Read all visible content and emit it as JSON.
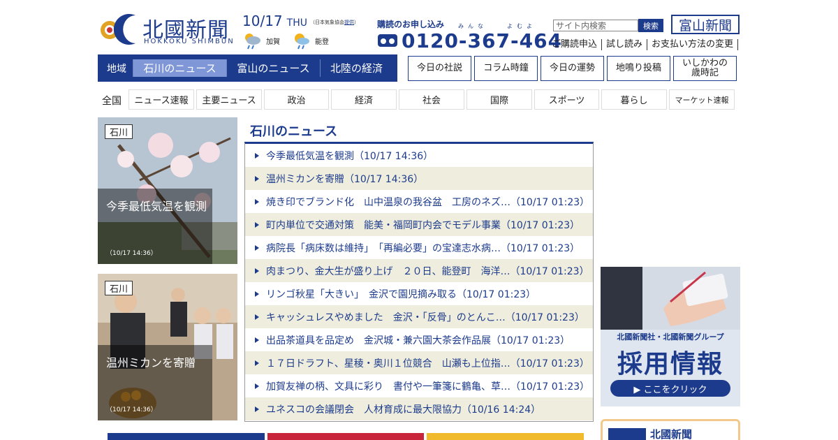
{
  "header": {
    "logo_name": "北國新聞",
    "logo_roman": "HOKKOKU SHIMBUN",
    "date": "10/17",
    "weekday": "THU",
    "weather_source_prefix": "（日本気象協会",
    "weather_source_link": "提供",
    "weather_source_suffix": "）",
    "weather": [
      {
        "label": "加賀",
        "icon": "cloud-sun-rain-icon"
      },
      {
        "label": "能登",
        "icon": "sun-rain-icon"
      }
    ],
    "subscribe_title": "購読のお申し込み",
    "phone_ruby": "みんな　　よむよ",
    "phone": "0120-367-464",
    "search_placeholder": "サイト内検索",
    "search_button": "検索",
    "toyama_link": "富山新聞",
    "links": [
      "ご購読申込",
      "試し読み",
      "お支払い方法の変更"
    ]
  },
  "region_nav": {
    "label": "地域",
    "tabs": [
      "石川のニュース",
      "富山のニュース",
      "北陸の経済"
    ],
    "active": 0
  },
  "box_links": [
    "今日の社説",
    "コラム時鐘",
    "今日の運勢",
    "地鳴り投稿",
    "いしかわの\n歳時記"
  ],
  "categories": {
    "label": "全国",
    "items": [
      "ニュース速報",
      "主要ニュース",
      "政治",
      "経済",
      "社会",
      "国際",
      "スポーツ",
      "暮らし",
      "マーケット速報"
    ]
  },
  "cards": [
    {
      "tag": "石川",
      "title": "今季最低気温を観測",
      "time": "（10/17 14:36）"
    },
    {
      "tag": "石川",
      "title": "温州ミカンを寄贈",
      "time": "（10/17 14:36）"
    }
  ],
  "news": {
    "title": "石川のニュース",
    "items": [
      "今季最低気温を観測（10/17 14:36）",
      "温州ミカンを寄贈（10/17 14:36）",
      "焼き印でブランド化　山中温泉の我谷盆　工房のネズ…（10/17 01:23）",
      "町内単位で交通対策　能美・福岡町内会でモデル事業（10/17 01:23）",
      "病院長「病床数は維持」　「再編必要」の宝達志水病…（10/17 01:23）",
      "肉まつり、金大生が盛り上げ　２０日、能登町　海洋…（10/17 01:23）",
      "リンゴ秋星「大きい」　金沢で園児摘み取る（10/17 01:23）",
      "キャッシュレスやめました　金沢・「反骨」のとんこ…（10/17 01:23）",
      "出品茶道具を品定め　金沢城・兼六園大茶会作品展（10/17 01:23）",
      "１７日ドラフト、星稜・奥川１位競合　山瀬も上位指…（10/17 01:23）",
      "加賀友禅の柄、文具に彩り　書付や一筆箋に鶴亀、草…（10/17 01:23）",
      "ユネスコの会議閉会　人材育成に最大限協力（10/16 14:24）"
    ]
  },
  "recruit": {
    "subtitle": "北國新聞社・北國新聞グループ",
    "title": "採用情報",
    "button": "▶ ここをクリック"
  },
  "bottom_box": {
    "title": "北國新聞"
  },
  "colors": {
    "brand": "#1d3b8c",
    "active_tab": "#7f97d6",
    "stripe": "#efeede",
    "accent_border": "#f2c98a"
  }
}
